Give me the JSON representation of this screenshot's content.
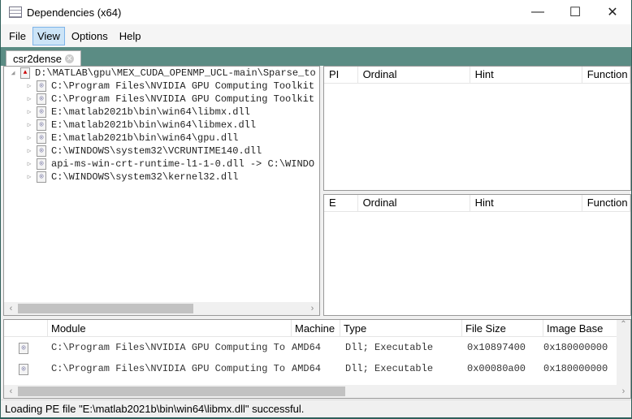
{
  "window": {
    "title": "Dependencies (x64)",
    "minimize": "—",
    "maximize": "☐",
    "close": "✕"
  },
  "menu": [
    "File",
    "View",
    "Options",
    "Help"
  ],
  "tab": {
    "label": "csr2dense",
    "close": "✕"
  },
  "tree": {
    "root": "D:\\MATLAB\\gpu\\MEX_CUDA_OPENMP_UCL-main\\Sparse_to",
    "children": [
      "C:\\Program Files\\NVIDIA GPU Computing Toolkit",
      "C:\\Program Files\\NVIDIA GPU Computing Toolkit",
      "E:\\matlab2021b\\bin\\win64\\libmx.dll",
      "E:\\matlab2021b\\bin\\win64\\libmex.dll",
      "E:\\matlab2021b\\bin\\win64\\gpu.dll",
      "C:\\WINDOWS\\system32\\VCRUNTIME140.dll",
      "api-ms-win-crt-runtime-l1-1-0.dll -> C:\\WINDO",
      "C:\\WINDOWS\\system32\\kernel32.dll"
    ]
  },
  "imports": {
    "headers": [
      "PI",
      "Ordinal",
      "Hint",
      "Function"
    ]
  },
  "exports": {
    "headers": [
      "E",
      "Ordinal",
      "Hint",
      "Function"
    ]
  },
  "modules": {
    "headers": [
      "",
      "Module",
      "Machine",
      "Type",
      "File Size",
      "Image Base"
    ],
    "rows": [
      [
        "C:\\Program Files\\NVIDIA GPU Computing To",
        "AMD64",
        "Dll; Executable",
        "0x10897400",
        "0x180000000"
      ],
      [
        "C:\\Program Files\\NVIDIA GPU Computing To",
        "AMD64",
        "Dll; Executable",
        "0x00080a00",
        "0x180000000"
      ]
    ]
  },
  "status": "Loading PE file \"E:\\matlab2021b\\bin\\win64\\libmx.dll\" successful."
}
